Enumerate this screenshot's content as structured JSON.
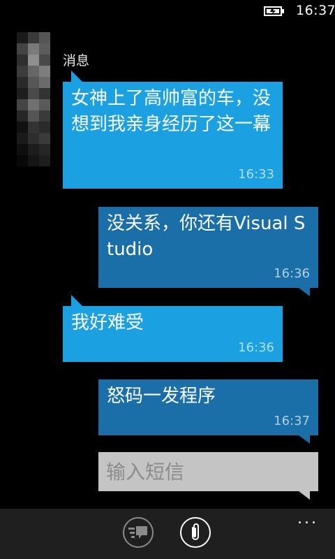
{
  "status": {
    "time": "16:37"
  },
  "thread": {
    "label": "消息"
  },
  "messages": [
    {
      "direction": "in",
      "text": "女神上了高帅富的车，没想到我亲身经历了这一幕",
      "time": "16:33"
    },
    {
      "direction": "out",
      "text": "没关系，你还有Visual Studio",
      "time": "16:36"
    },
    {
      "direction": "in",
      "text": "我好难受",
      "time": "16:36"
    },
    {
      "direction": "out",
      "text": "怒码一发程序",
      "time": "16:37"
    }
  ],
  "compose": {
    "placeholder": "输入短信"
  },
  "app_bar": {
    "buttons": [
      {
        "icon": "voice-message-icon"
      },
      {
        "icon": "attachment-icon"
      }
    ],
    "more": "..."
  },
  "colors": {
    "incoming": "#1ba1e2",
    "outgoing": "#1b6fa8",
    "compose": "#c4c4c4",
    "background": "#000000",
    "app_bar": "#1f1f1f"
  }
}
